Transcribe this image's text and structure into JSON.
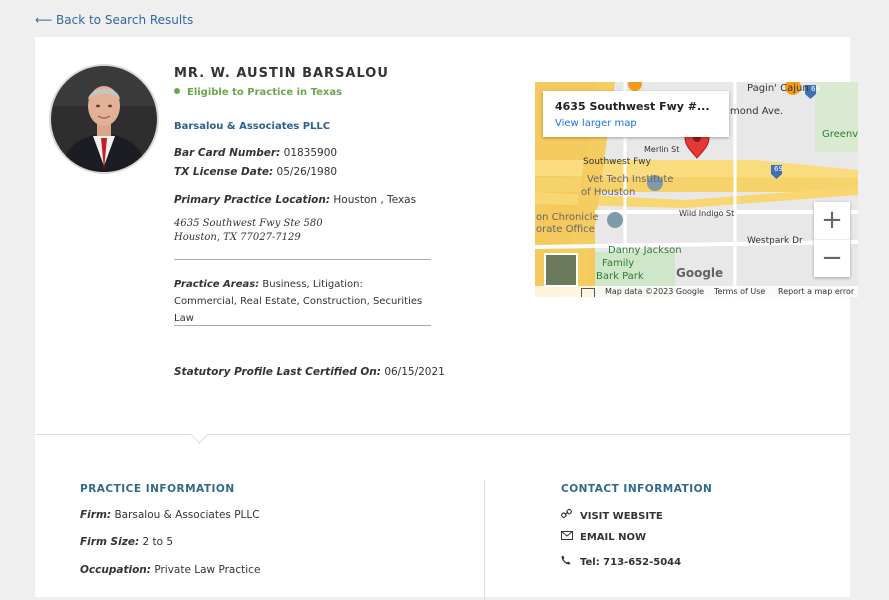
{
  "nav": {
    "back_label": "⟵ Back to Search Results"
  },
  "profile": {
    "name": "MR. W. AUSTIN BARSALOU",
    "eligibility": "Eligible to Practice in Texas",
    "firm_link": "Barsalou & Associates PLLC",
    "bar_card_label": "Bar Card Number:",
    "bar_card_value": "01835900",
    "license_label": "TX License Date:",
    "license_value": "05/26/1980",
    "location_label": "Primary Practice Location:",
    "location_value": "Houston , Texas",
    "address_line1": "4635 Southwest Fwy Ste 580",
    "address_line2": "Houston, TX 77027-7129",
    "practice_areas_label": "Practice Areas:",
    "practice_areas_value": "Business, Litigation: Commercial, Real Estate, Construction, Securities Law",
    "certified_label": "Statutory Profile Last Certified On:",
    "certified_value": "06/15/2021"
  },
  "map": {
    "title": "4635 Southwest Fwy #...",
    "larger_link": "View larger map",
    "labels": {
      "cajun": "Pagin' Cajun",
      "richmond": "mond Ave.",
      "greenway": "Greenv",
      "merlin": "Merlin St",
      "sw_fwy": "Southwest Fwy",
      "vet_tech": "Vet Tech Institute",
      "of_houston": "of Houston",
      "chronicle": "on Chronicle",
      "office": "orate Office",
      "wild_indigo": "Wild Indigo St",
      "westpark": "Westpark Dr",
      "danny": "Danny Jackson",
      "family": "Family",
      "bark": "Bark Park",
      "i69a": "69",
      "i69b": "69"
    },
    "google": "Google",
    "footer_data": "Map data ©2023 Google",
    "footer_terms": "Terms of Use",
    "footer_report": "Report a map error",
    "zoom_in": "+",
    "zoom_out": "−"
  },
  "practice_info": {
    "title": "PRACTICE INFORMATION",
    "firm_label": "Firm:",
    "firm_value": "Barsalou & Associates PLLC",
    "size_label": "Firm Size:",
    "size_value": "2 to 5",
    "occupation_label": "Occupation:",
    "occupation_value": "Private Law Practice"
  },
  "contact_info": {
    "title": "CONTACT INFORMATION",
    "website": "VISIT WEBSITE",
    "email": "EMAIL NOW",
    "phone": "Tel: 713-652-5044"
  },
  "icons": {
    "link": "link-icon",
    "envelope": "envelope-icon",
    "phone": "phone-icon"
  }
}
